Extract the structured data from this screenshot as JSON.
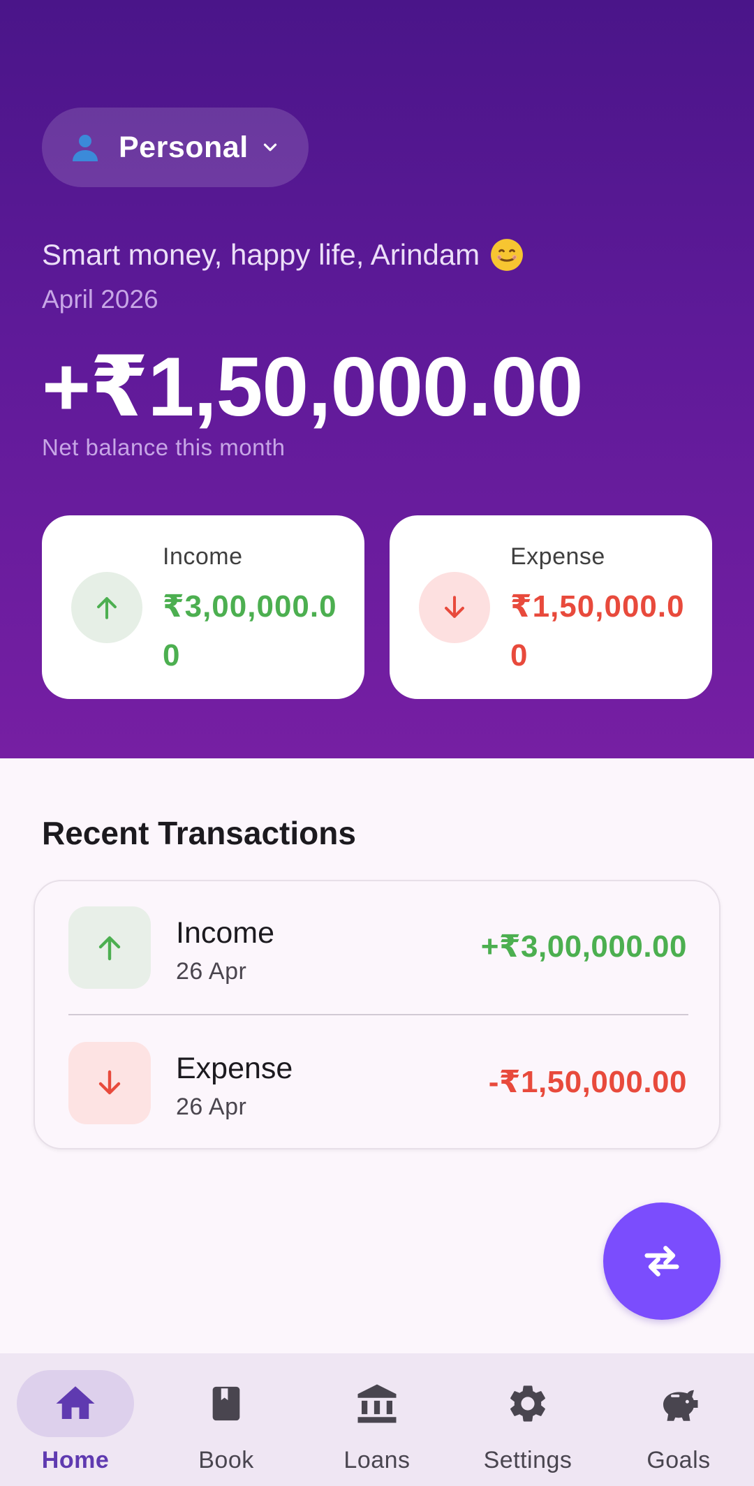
{
  "header": {
    "profile_label": "Personal",
    "profile_icon": "person-icon",
    "greeting": "Smart money, happy life, Arindam",
    "greeting_emoji": "😊",
    "month": "April 2026",
    "net_balance": "+₹1,50,000.00",
    "net_balance_label": "Net balance this month"
  },
  "summary": {
    "income": {
      "title": "Income",
      "amount": "₹3,00,000.00",
      "color": "#4caf50"
    },
    "expense": {
      "title": "Expense",
      "amount": "₹1,50,000.00",
      "color": "#e84a3c"
    }
  },
  "recent": {
    "title": "Recent Transactions",
    "items": [
      {
        "name": "Income",
        "date": "26 Apr",
        "amount": "+₹3,00,000.00",
        "type": "income"
      },
      {
        "name": "Expense",
        "date": "26 Apr",
        "amount": "-₹1,50,000.00",
        "type": "expense"
      }
    ]
  },
  "fab": {
    "icon": "swap-arrows-icon"
  },
  "nav": {
    "items": [
      {
        "label": "Home",
        "icon": "home-icon",
        "active": true
      },
      {
        "label": "Book",
        "icon": "book-icon",
        "active": false
      },
      {
        "label": "Loans",
        "icon": "bank-icon",
        "active": false
      },
      {
        "label": "Settings",
        "icon": "gear-icon",
        "active": false
      },
      {
        "label": "Goals",
        "icon": "piggy-bank-icon",
        "active": false
      }
    ]
  },
  "colors": {
    "header_top": "#4a1589",
    "header_bottom": "#761fa3",
    "accent": "#7b4dfd",
    "income": "#4caf50",
    "expense": "#e84a3c"
  }
}
